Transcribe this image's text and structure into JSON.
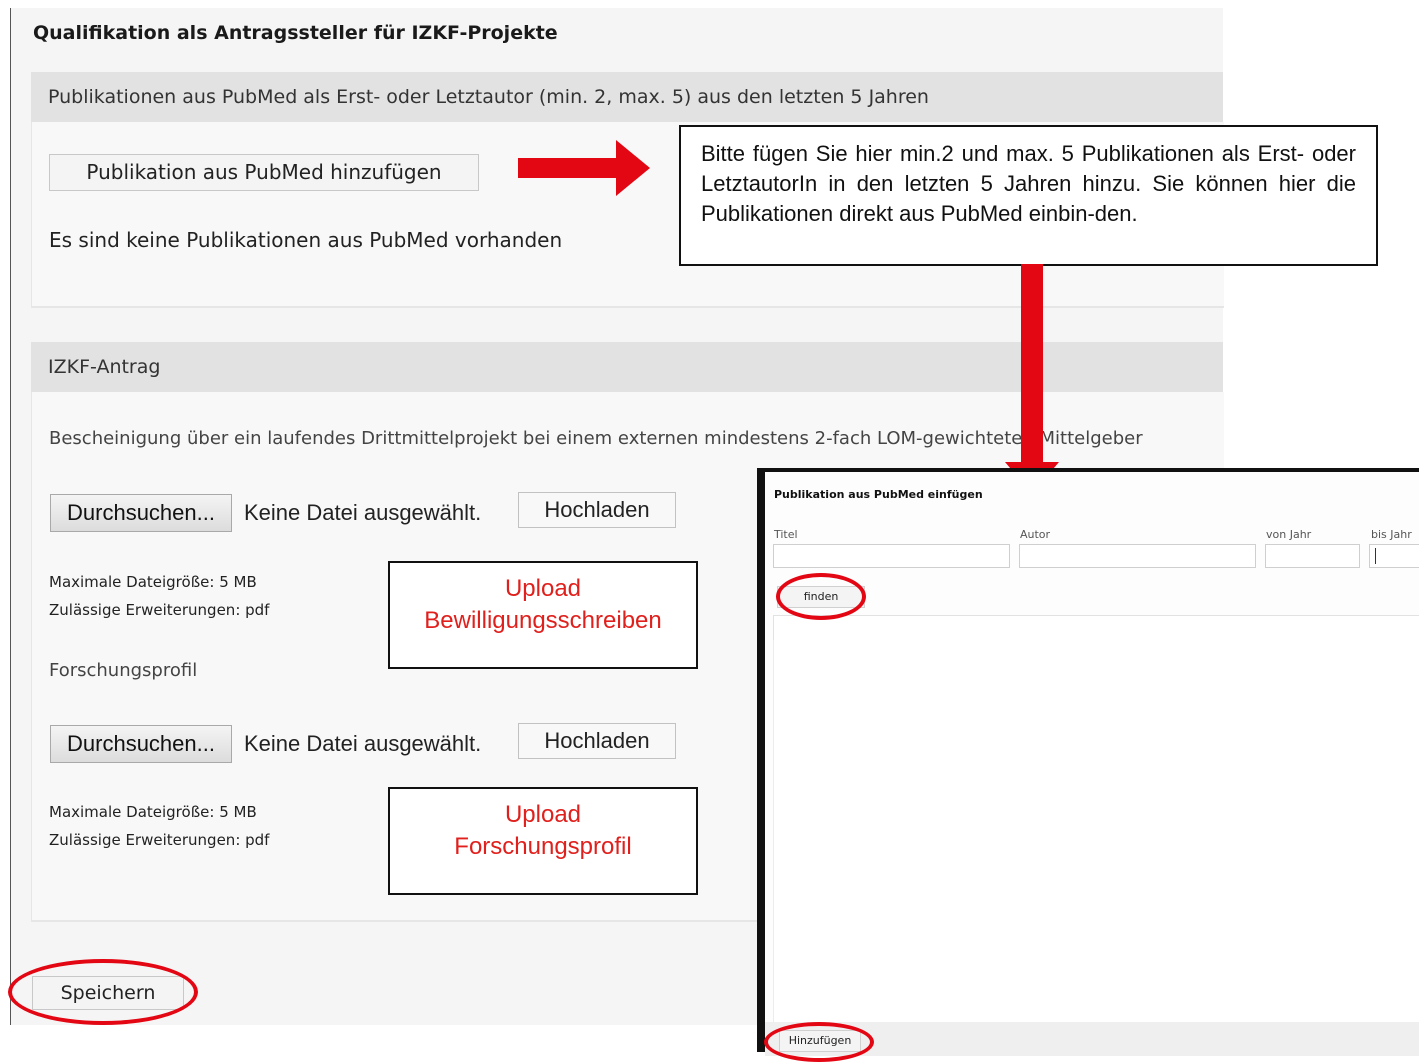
{
  "page": {
    "title": "Qualifikation als Antragssteller für IZKF-Projekte",
    "save_label": "Speichern"
  },
  "pubmed_section": {
    "header": "Publikationen aus PubMed als Erst- oder Letztautor (min. 2, max. 5) aus den letzten 5 Jahren",
    "add_button": "Publikation aus PubMed hinzufügen",
    "empty_text": "Es sind keine Publikationen aus PubMed vorhanden"
  },
  "info_note": {
    "text": "Bitte fügen Sie hier min.2 und max. 5 Publikationen als Erst- oder LetztautorIn in den letzten 5 Jahren hinzu. Sie können hier die Publikationen direkt aus PubMed einbin-den."
  },
  "izkf_section": {
    "header": "IZKF-Antrag",
    "certificate_label": "Bescheinigung über ein laufendes Drittmittelprojekt bei einem externen mindestens 2-fach LOM-gewichteten Mittelgeber",
    "uploads": [
      {
        "browse_label": "Durchsuchen...",
        "no_file_text": "Keine Datei ausgewählt.",
        "upload_label": "Hochladen",
        "max_size": "Maximale Dateigröße: 5 MB",
        "extensions": "Zulässige Erweiterungen: pdf",
        "callout_line1": "Upload",
        "callout_line2": "Bewilligungsschreiben"
      },
      {
        "browse_label": "Durchsuchen...",
        "no_file_text": "Keine Datei ausgewählt.",
        "upload_label": "Hochladen",
        "max_size": "Maximale Dateigröße: 5 MB",
        "extensions": "Zulässige Erweiterungen: pdf",
        "callout_line1": "Upload",
        "callout_line2": "Forschungsprofil"
      }
    ],
    "research_profile_label": "Forschungsprofil"
  },
  "dialog": {
    "title": "Publikation aus PubMed einfügen",
    "fields": {
      "title_label": "Titel",
      "author_label": "Autor",
      "from_year_label": "von Jahr",
      "to_year_label": "bis Jahr"
    },
    "find_button": "finden",
    "add_button": "Hinzufügen"
  },
  "colors": {
    "annotation_red": "#e30613",
    "callout_text": "#e0201c",
    "section_header_bg": "#e2e2e2"
  }
}
